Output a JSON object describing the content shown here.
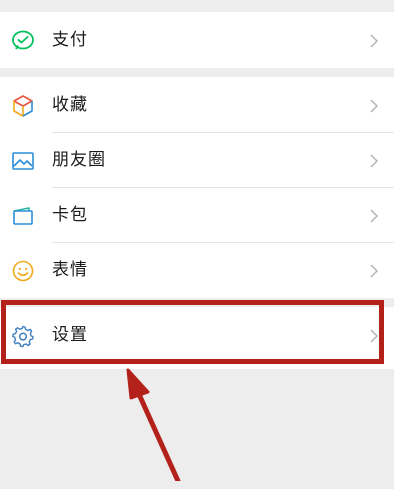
{
  "menu": {
    "pay": {
      "label": "支付",
      "icon": "wechat-pay-icon"
    },
    "favorites": {
      "label": "收藏",
      "icon": "favorites-cube-icon"
    },
    "moments": {
      "label": "朋友圈",
      "icon": "moments-picture-icon"
    },
    "cards": {
      "label": "卡包",
      "icon": "card-wallet-icon"
    },
    "stickers": {
      "label": "表情",
      "icon": "smiley-icon"
    },
    "settings": {
      "label": "设置",
      "icon": "gear-icon"
    }
  },
  "annotation": {
    "highlight_color": "#b4211b",
    "arrow_color": "#b4211b"
  },
  "colors": {
    "page_background": "#ededed",
    "row_background": "#ffffff",
    "pay_green": "#07c160",
    "cards_blue": "#2a8fd7",
    "stickers_yellow": "#f0a81c",
    "settings_blue": "#3d7fc2"
  }
}
